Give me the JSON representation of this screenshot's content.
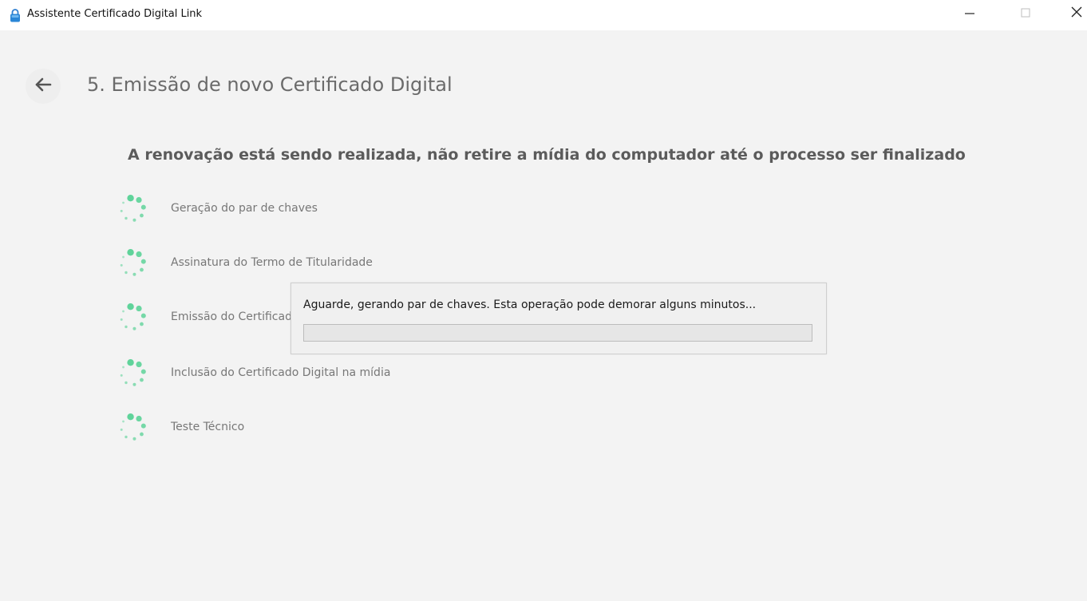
{
  "window": {
    "title": "Assistente Certificado Digital Link",
    "icon": "lock-icon",
    "controls": [
      "minimize-icon",
      "maximize-icon",
      "close-icon"
    ]
  },
  "header": {
    "back_icon": "arrow-left-icon",
    "title": "5. Emissão de novo Certificado Digital"
  },
  "main": {
    "subtitle": "A renovação está sendo realizada, não retire a mídia do computador até o processo ser finalizado",
    "steps": [
      {
        "label": "Geração do par de chaves",
        "status_icon": "spinner-icon"
      },
      {
        "label": "Assinatura do Termo de Titularidade",
        "status_icon": "spinner-icon"
      },
      {
        "label": "Emissão do Certificado Digital",
        "status_icon": "spinner-icon"
      },
      {
        "label": "Inclusão do Certificado Digital na mídia",
        "status_icon": "spinner-icon"
      },
      {
        "label": "Teste Técnico",
        "status_icon": "spinner-icon"
      }
    ]
  },
  "dialog": {
    "message": "Aguarde, gerando par de chaves. Esta operação pode demorar alguns minutos...",
    "progress": 0
  },
  "colors": {
    "spinner": "#5fd39a",
    "background": "#f3f3f3",
    "titlebar": "#ffffff",
    "progress_fill": "#06b025"
  }
}
